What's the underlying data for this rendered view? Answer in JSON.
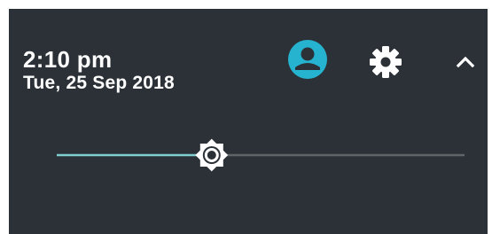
{
  "status": {
    "time": "2:10 pm",
    "date": "Tue, 25 Sep 2018"
  },
  "icons": {
    "user": "user-account-icon",
    "settings": "gear-icon",
    "collapse": "chevron-up-icon",
    "brightness": "brightness-icon"
  },
  "brightness": {
    "level": 0.38
  },
  "colors": {
    "panel_background": "#2b3136",
    "accent": "#26b3cf",
    "slider_active": "#7fcfd0",
    "slider_inactive": "#5f6468",
    "foreground": "#ffffff"
  }
}
